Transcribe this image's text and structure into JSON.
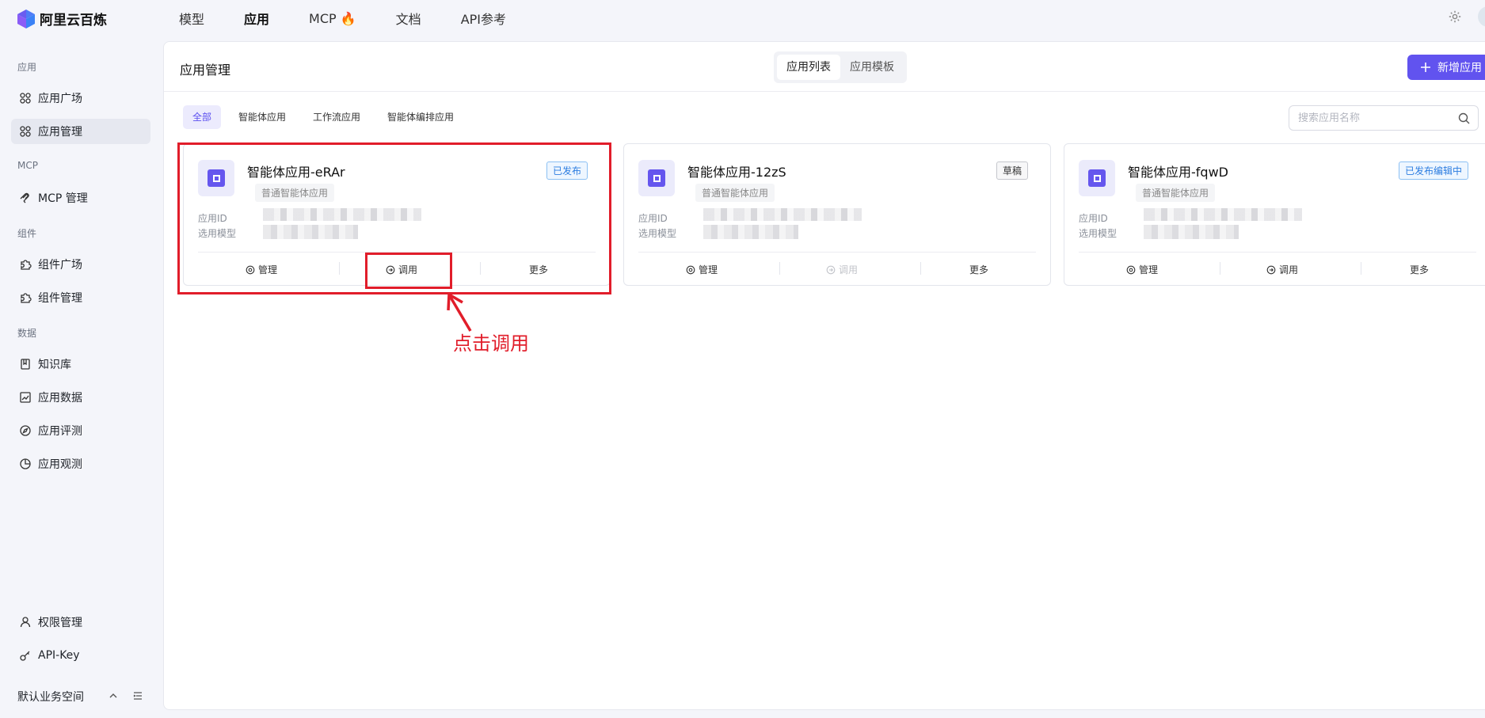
{
  "app": {
    "name": "阿里云百炼"
  },
  "topnav": [
    {
      "label": "模型",
      "active": false
    },
    {
      "label": "应用",
      "active": true
    },
    {
      "label": "MCP 🔥",
      "active": false
    },
    {
      "label": "文档",
      "active": false
    },
    {
      "label": "API参考",
      "active": false
    }
  ],
  "sidebar": {
    "sections": {
      "app": "应用",
      "mcp": "MCP",
      "component": "组件",
      "data": "数据"
    },
    "items": [
      {
        "label": "应用广场",
        "icon": "apps-icon"
      },
      {
        "label": "应用管理",
        "icon": "apps-icon",
        "active": true
      },
      {
        "label": "MCP 管理",
        "icon": "mcp-icon"
      },
      {
        "label": "组件广场",
        "icon": "puzzle-icon"
      },
      {
        "label": "组件管理",
        "icon": "puzzle-icon"
      },
      {
        "label": "知识库",
        "icon": "book-icon"
      },
      {
        "label": "应用数据",
        "icon": "chart-icon"
      },
      {
        "label": "应用评测",
        "icon": "compass-icon"
      },
      {
        "label": "应用观测",
        "icon": "pie-icon"
      },
      {
        "label": "权限管理",
        "icon": "user-icon"
      },
      {
        "label": "API-Key",
        "icon": "key-icon"
      }
    ],
    "workspace": "默认业务空间"
  },
  "main": {
    "title": "应用管理",
    "tabs": [
      "应用列表",
      "应用模板"
    ],
    "new_button": "新增应用",
    "filters": [
      "全部",
      "智能体应用",
      "工作流应用",
      "智能体编排应用"
    ],
    "search_placeholder": "搜索应用名称",
    "cards": [
      {
        "name": "智能体应用-eRAr",
        "type": "普通智能体应用",
        "status": "已发布",
        "id_label": "应用ID",
        "model_label": "选用模型",
        "actions": [
          "管理",
          "调用",
          "更多"
        ]
      },
      {
        "name": "智能体应用-12zS",
        "type": "普通智能体应用",
        "status": "草稿",
        "id_label": "应用ID",
        "model_label": "选用模型",
        "actions": [
          "管理",
          "调用",
          "更多"
        ]
      },
      {
        "name": "智能体应用-fqwD",
        "type": "普通智能体应用",
        "status": "已发布编辑中",
        "id_label": "应用ID",
        "model_label": "选用模型",
        "actions": [
          "管理",
          "调用",
          "更多"
        ]
      }
    ]
  },
  "annotation": {
    "text": "点击调用"
  },
  "colors": {
    "accent": "#6153ef",
    "annotation": "#e11d2a",
    "published": "#2c7de0"
  }
}
